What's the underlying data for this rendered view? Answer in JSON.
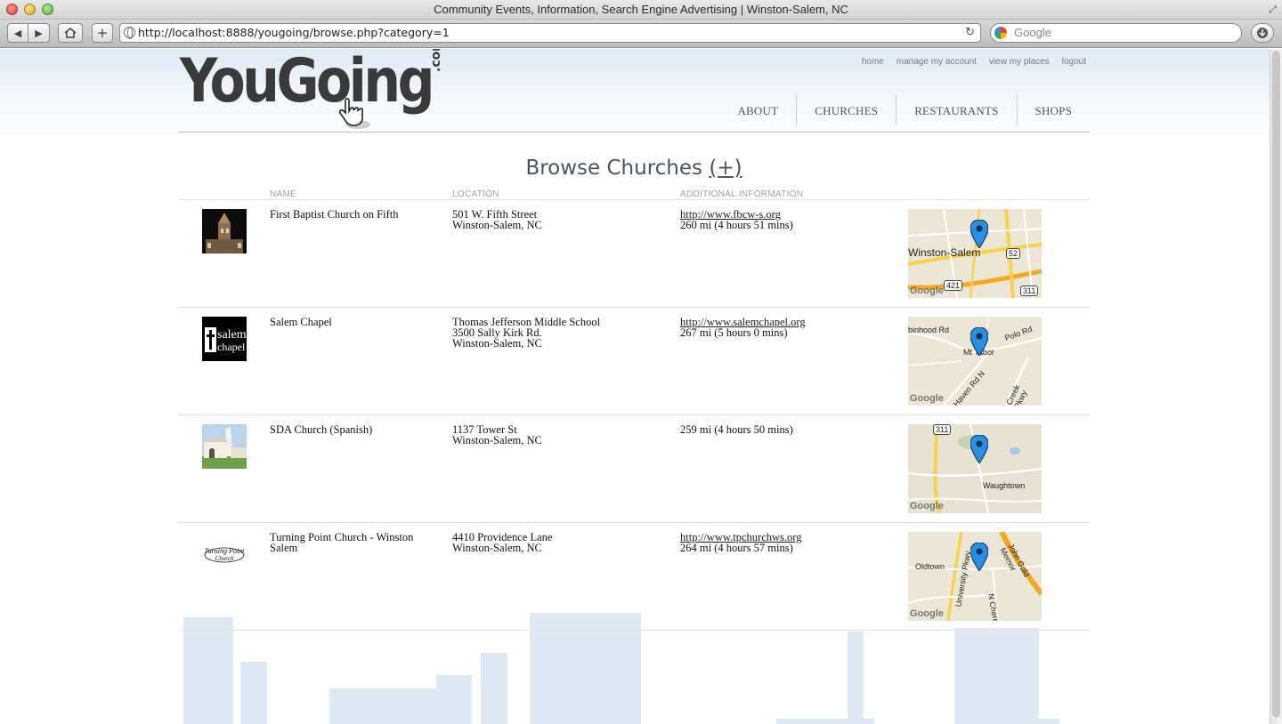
{
  "window": {
    "title": "Community Events, Information, Search Engine Advertising | Winston-Salem, NC"
  },
  "toolbar": {
    "url": "http://localhost:8888/yougoing/browse.php?category=1",
    "search_placeholder": "Google"
  },
  "site": {
    "logo_text": "YouGoing",
    "logo_suffix": ".com",
    "top_links": [
      "home",
      "manage my account",
      "view my places",
      "logout"
    ],
    "nav": [
      "ABOUT",
      "CHURCHES",
      "RESTAURANTS",
      "SHOPS"
    ]
  },
  "browse": {
    "title": "Browse Churches",
    "add_label": "(+)",
    "columns": [
      "NAME",
      "LOCATION",
      "ADDITIONAL INFORMATION"
    ]
  },
  "listings": [
    {
      "name": "First Baptist Church on Fifth",
      "location": [
        "501 W. Fifth Street",
        "Winston-Salem, NC"
      ],
      "url": "http://www.fbcw-s.org",
      "distance": "260 mi (4 hours 51 mins)",
      "map_labels": [
        "Winston-Salem",
        "52",
        "421",
        "311"
      ]
    },
    {
      "name": "Salem Chapel",
      "location": [
        "Thomas Jefferson Middle School",
        "3500 Sally Kirk Rd.",
        "Winston-Salem, NC"
      ],
      "url": "http://www.salemchapel.org",
      "distance": "267 mi (5 hours 0 mins)",
      "map_labels": [
        "Mt Tabor",
        "Polo Rd",
        "Haven Rd N",
        "Creek Pkwy",
        "binhood Rd"
      ]
    },
    {
      "name": "SDA Church (Spanish)",
      "location": [
        "1137 Tower St",
        "Winston-Salem, NC"
      ],
      "url": "",
      "distance": "259 mi (4 hours 50 mins)",
      "map_labels": [
        "Waughtown",
        "311"
      ]
    },
    {
      "name": "Turning Point Church - Winston Salem",
      "location": [
        "4410 Providence Lane",
        "Winston-Salem, NC"
      ],
      "url": "http://www.tpchurchws.org",
      "distance": "264 mi (4 hours 57 mins)",
      "map_labels": [
        "Oldtown",
        "University Pkwy",
        "John Gold Memor",
        "N Cherr"
      ]
    }
  ],
  "thumb_text": {
    "salem": [
      "salem",
      "chapel"
    ],
    "turning_point": [
      "Turning Point",
      "Church"
    ]
  },
  "map_brand": "Google"
}
